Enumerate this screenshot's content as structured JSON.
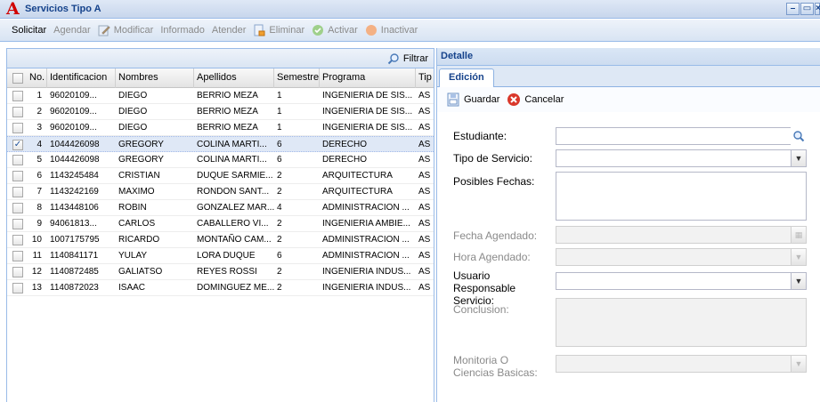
{
  "window": {
    "title": "Servicios Tipo A",
    "logo_letter": "A"
  },
  "toolbar": {
    "solicitar": "Solicitar",
    "agendar": "Agendar",
    "modificar": "Modificar",
    "informado": "Informado",
    "atender": "Atender",
    "eliminar": "Eliminar",
    "activar": "Activar",
    "inactivar": "Inactivar"
  },
  "grid": {
    "filter_label": "Filtrar",
    "columns": [
      "No.",
      "Identificacion",
      "Nombres",
      "Apellidos",
      "Semestre",
      "Programa",
      "Tip"
    ],
    "rows": [
      {
        "no": "1",
        "id": "96020109...",
        "nombres": "DIEGO",
        "apellidos": "BERRIO MEZA",
        "semestre": "1",
        "programa": "INGENIERIA DE SIS...",
        "tipo": "AS",
        "checked": false
      },
      {
        "no": "2",
        "id": "96020109...",
        "nombres": "DIEGO",
        "apellidos": "BERRIO MEZA",
        "semestre": "1",
        "programa": "INGENIERIA DE SIS...",
        "tipo": "AS",
        "checked": false
      },
      {
        "no": "3",
        "id": "96020109...",
        "nombres": "DIEGO",
        "apellidos": "BERRIO MEZA",
        "semestre": "1",
        "programa": "INGENIERIA DE SIS...",
        "tipo": "AS",
        "checked": false
      },
      {
        "no": "4",
        "id": "1044426098",
        "nombres": "GREGORY",
        "apellidos": "COLINA MARTI...",
        "semestre": "6",
        "programa": "DERECHO",
        "tipo": "AS",
        "checked": true
      },
      {
        "no": "5",
        "id": "1044426098",
        "nombres": "GREGORY",
        "apellidos": "COLINA MARTI...",
        "semestre": "6",
        "programa": "DERECHO",
        "tipo": "AS",
        "checked": false
      },
      {
        "no": "6",
        "id": "1143245484",
        "nombres": "CRISTIAN",
        "apellidos": "DUQUE SARMIE...",
        "semestre": "2",
        "programa": "ARQUITECTURA",
        "tipo": "AS",
        "checked": false
      },
      {
        "no": "7",
        "id": "1143242169",
        "nombres": "MAXIMO",
        "apellidos": "RONDON SANT...",
        "semestre": "2",
        "programa": "ARQUITECTURA",
        "tipo": "AS",
        "checked": false
      },
      {
        "no": "8",
        "id": "1143448106",
        "nombres": "ROBIN",
        "apellidos": "GONZALEZ MAR...",
        "semestre": "4",
        "programa": "ADMINISTRACION ...",
        "tipo": "AS",
        "checked": false
      },
      {
        "no": "9",
        "id": "94061813...",
        "nombres": "CARLOS",
        "apellidos": "CABALLERO VI...",
        "semestre": "2",
        "programa": "INGENIERIA AMBIE...",
        "tipo": "AS",
        "checked": false
      },
      {
        "no": "10",
        "id": "1007175795",
        "nombres": "RICARDO",
        "apellidos": "MONTAÑO CAM...",
        "semestre": "2",
        "programa": "ADMINISTRACION ...",
        "tipo": "AS",
        "checked": false
      },
      {
        "no": "11",
        "id": "1140841171",
        "nombres": "YULAY",
        "apellidos": "LORA DUQUE",
        "semestre": "6",
        "programa": "ADMINISTRACION ...",
        "tipo": "AS",
        "checked": false
      },
      {
        "no": "12",
        "id": "1140872485",
        "nombres": "GALIATSO",
        "apellidos": "REYES ROSSI",
        "semestre": "2",
        "programa": "INGENIERIA INDUS...",
        "tipo": "AS",
        "checked": false
      },
      {
        "no": "13",
        "id": "1140872023",
        "nombres": "ISAAC",
        "apellidos": "DOMINGUEZ ME...",
        "semestre": "2",
        "programa": "INGENIERIA INDUS...",
        "tipo": "AS",
        "checked": false
      }
    ],
    "selected_row": 3
  },
  "detail": {
    "title": "Detalle",
    "tab": "Edición",
    "guardar": "Guardar",
    "cancelar": "Cancelar",
    "fields": {
      "estudiante": "Estudiante:",
      "tipo_servicio": "Tipo de Servicio:",
      "posibles_fechas": "Posibles Fechas:",
      "fecha_agendado": "Fecha Agendado:",
      "hora_agendado": "Hora Agendado:",
      "usuario_responsable": "Usuario Responsable Servicio:",
      "conclusion": "Conclusion:",
      "monitoria": "Monitoria O Ciencias Basicas:"
    }
  },
  "colors": {
    "accent": "#15428b",
    "border": "#99bbe8",
    "selected_row": "#dfe8f6",
    "logo": "#d10000"
  }
}
